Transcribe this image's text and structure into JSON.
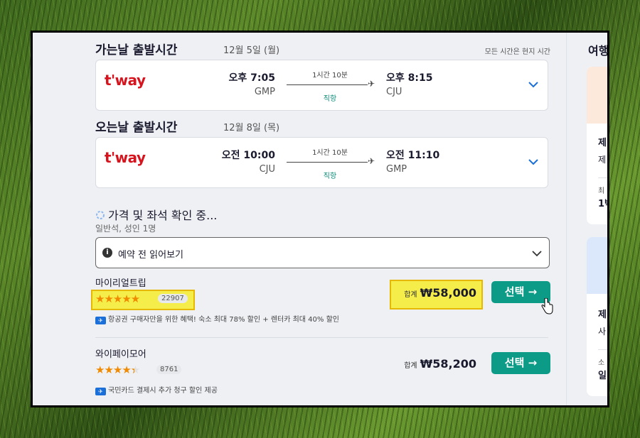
{
  "outbound": {
    "title": "가는날 출발시간",
    "date": "12월 5일 (월)",
    "timezone_note": "모든 시간은 현지 시간",
    "airline": "t'way",
    "dep_time": "오후 7:05",
    "dep_airport": "GMP",
    "duration": "1시간 10분",
    "stops": "직항",
    "arr_time": "오후 8:15",
    "arr_airport": "CJU"
  },
  "inbound": {
    "title": "오는날 출발시간",
    "date": "12월 8일 (목)",
    "airline": "t'way",
    "dep_time": "오전 10:00",
    "dep_airport": "CJU",
    "duration": "1시간 10분",
    "stops": "직항",
    "arr_time": "오전 11:10",
    "arr_airport": "GMP"
  },
  "status": {
    "loading_text": "가격 및 좌석 확인 중...",
    "cabin": "일반석, 성인 1명"
  },
  "read_before": {
    "label": "예약 전 읽어보기"
  },
  "providers": [
    {
      "name": "마이리얼트립",
      "stars": "★★★★★",
      "rating": 5,
      "reviews": "22907",
      "promo": "항공권 구매자만을 위한 혜택! 숙소 최대 78% 할인 + 렌터카 최대 40% 할인",
      "total_label": "합계",
      "price": "₩58,000",
      "button": "선택 →"
    },
    {
      "name": "와이페이모어",
      "stars": "★★★★★",
      "rating": 4.5,
      "reviews": "8761",
      "promo": "국민카드 결제시 추가 청구 할인 제공",
      "total_label": "합계",
      "price": "₩58,200",
      "button": "선택 →"
    }
  ],
  "right_panel": {
    "title": "여행",
    "card1_line1": "제",
    "card1_line2": "제",
    "card1_small": "최",
    "card1_line3": "1박",
    "card2_line1": "제",
    "card2_line2": "사",
    "card2_small": "소",
    "card2_line3": "일"
  },
  "colors": {
    "accent": "#0b9b87",
    "highlight": "#f4ed4a",
    "star": "#f08a00",
    "airline": "#d7141e"
  },
  "icons": {
    "chevron": "chevron-down-icon",
    "plane": "plane-icon",
    "info": "info-icon",
    "promo": "promo-badge-icon",
    "spinner": "loading-spinner-icon",
    "cursor": "hand-cursor-icon"
  }
}
